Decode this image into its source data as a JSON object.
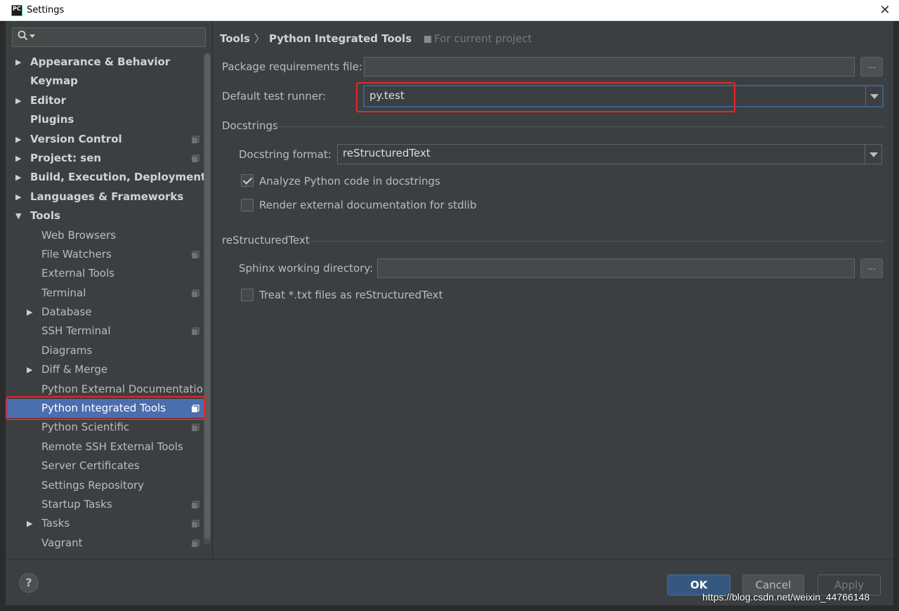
{
  "window": {
    "title": "Settings",
    "app_icon_text": "PC",
    "close_glyph": "✕"
  },
  "search": {
    "placeholder": "",
    "icon": "search-icon"
  },
  "tree": [
    {
      "label": "Appearance & Behavior",
      "level": 0,
      "arrow": "▶",
      "project": false
    },
    {
      "label": "Keymap",
      "level": 0,
      "arrow": "",
      "project": false
    },
    {
      "label": "Editor",
      "level": 0,
      "arrow": "▶",
      "project": false
    },
    {
      "label": "Plugins",
      "level": 0,
      "arrow": "",
      "project": false
    },
    {
      "label": "Version Control",
      "level": 0,
      "arrow": "▶",
      "project": true
    },
    {
      "label": "Project: sen",
      "level": 0,
      "arrow": "▶",
      "project": true
    },
    {
      "label": "Build, Execution, Deployment",
      "level": 0,
      "arrow": "▶",
      "project": false
    },
    {
      "label": "Languages & Frameworks",
      "level": 0,
      "arrow": "▶",
      "project": false
    },
    {
      "label": "Tools",
      "level": 0,
      "arrow": "▼",
      "project": false
    },
    {
      "label": "Web Browsers",
      "level": 1,
      "arrow": "",
      "project": false
    },
    {
      "label": "File Watchers",
      "level": 1,
      "arrow": "",
      "project": true
    },
    {
      "label": "External Tools",
      "level": 1,
      "arrow": "",
      "project": false
    },
    {
      "label": "Terminal",
      "level": 1,
      "arrow": "",
      "project": true
    },
    {
      "label": "Database",
      "level": 1,
      "arrow": "▶",
      "project": false
    },
    {
      "label": "SSH Terminal",
      "level": 1,
      "arrow": "",
      "project": true
    },
    {
      "label": "Diagrams",
      "level": 1,
      "arrow": "",
      "project": false
    },
    {
      "label": "Diff & Merge",
      "level": 1,
      "arrow": "▶",
      "project": false
    },
    {
      "label": "Python External Documentation",
      "level": 1,
      "arrow": "",
      "project": false
    },
    {
      "label": "Python Integrated Tools",
      "level": 1,
      "arrow": "",
      "project": true,
      "selected": true
    },
    {
      "label": "Python Scientific",
      "level": 1,
      "arrow": "",
      "project": true
    },
    {
      "label": "Remote SSH External Tools",
      "level": 1,
      "arrow": "",
      "project": false
    },
    {
      "label": "Server Certificates",
      "level": 1,
      "arrow": "",
      "project": false
    },
    {
      "label": "Settings Repository",
      "level": 1,
      "arrow": "",
      "project": false
    },
    {
      "label": "Startup Tasks",
      "level": 1,
      "arrow": "",
      "project": true
    },
    {
      "label": "Tasks",
      "level": 1,
      "arrow": "▶",
      "project": true
    },
    {
      "label": "Vagrant",
      "level": 1,
      "arrow": "",
      "project": true
    }
  ],
  "breadcrumb": {
    "parent": "Tools",
    "separator": "〉",
    "current": "Python Integrated Tools",
    "scope": "For current project"
  },
  "form": {
    "package_requirements_label": "Package requirements file:",
    "package_requirements_value": "",
    "browse_label": "...",
    "test_runner_label": "Default test runner:",
    "test_runner_value": "py.test",
    "docstrings_group": "Docstrings",
    "docstring_format_label": "Docstring format:",
    "docstring_format_value": "reStructuredText",
    "analyze_label": "Analyze Python code in docstrings",
    "analyze_checked": true,
    "render_label": "Render external documentation for stdlib",
    "render_checked": false,
    "rst_group": "reStructuredText",
    "sphinx_label": "Sphinx working directory:",
    "sphinx_value": "",
    "treat_txt_label": "Treat *.txt files as reStructuredText",
    "treat_txt_checked": false
  },
  "buttons": {
    "help": "?",
    "ok": "OK",
    "cancel": "Cancel",
    "apply": "Apply"
  },
  "watermark": "https://blog.csdn.net/weixin_44766148",
  "colors": {
    "selection": "#4b6eaf",
    "highlight": "#e8262a",
    "ok_button": "#365880",
    "background": "#3c3f41"
  }
}
